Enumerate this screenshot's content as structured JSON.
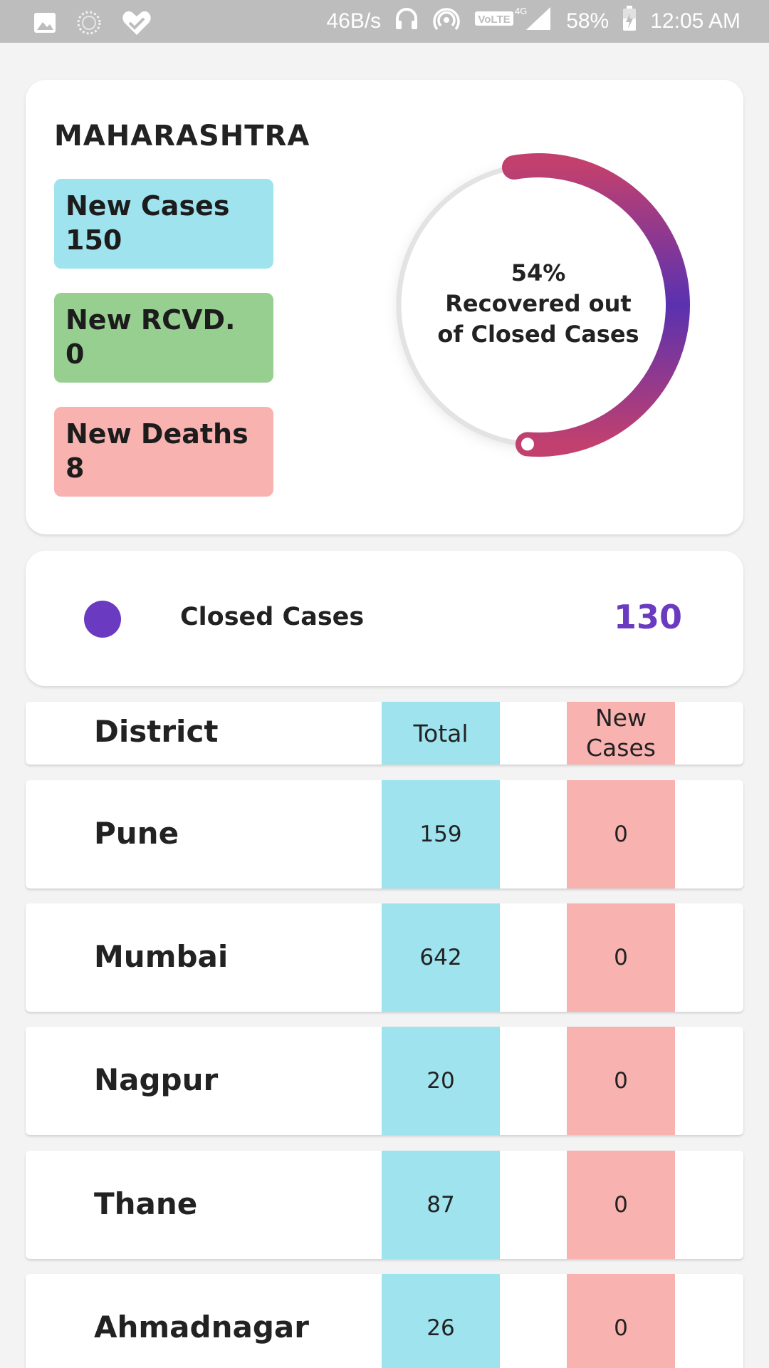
{
  "status_bar": {
    "net_speed": "46B/s",
    "network": "VoLTE 4G",
    "battery": "58%",
    "time": "12:05 AM",
    "left_icons": [
      "image-icon",
      "spinner-icon",
      "heart-check-icon"
    ]
  },
  "summary": {
    "state": "MAHARASHTRA",
    "new_cases_label": "New Cases",
    "new_cases_value": "150",
    "new_rcvd_label": "New RCVD.",
    "new_rcvd_value": "0",
    "new_deaths_label": "New Deaths",
    "new_deaths_value": "8",
    "donut": {
      "percent_text": "54%",
      "caption_line1": "Recovered out",
      "caption_line2": "of Closed Cases",
      "fraction": 0.54
    }
  },
  "closed": {
    "label": "Closed Cases",
    "value": "130"
  },
  "table": {
    "headers": {
      "district": "District",
      "total": "Total",
      "new_cases": "New Cases"
    },
    "rows": [
      {
        "district": "Pune",
        "total": "159",
        "new": "0"
      },
      {
        "district": "Mumbai",
        "total": "642",
        "new": "0"
      },
      {
        "district": "Nagpur",
        "total": "20",
        "new": "0"
      },
      {
        "district": "Thane",
        "total": "87",
        "new": "0"
      },
      {
        "district": "Ahmadnagar",
        "total": "26",
        "new": "0"
      }
    ]
  },
  "colors": {
    "accent": "#6a3bc0",
    "cases": "#9fe3ee",
    "recovered": "#96cf90",
    "deaths": "#f8b2b0",
    "gradient_start": "#c2406e",
    "gradient_end": "#5a31b0"
  }
}
